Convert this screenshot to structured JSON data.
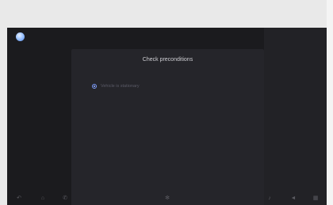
{
  "dialog": {
    "title": "Check preconditions",
    "items": [
      {
        "label": "Vehicle is stationary"
      }
    ]
  },
  "background": {
    "left_text": [
      "",
      ""
    ],
    "right_text": [
      "",
      ""
    ]
  },
  "icons": {
    "avatar": "avatar-icon",
    "bottom_left": [
      "back-icon",
      "home-icon",
      "phone-icon"
    ],
    "bottom_center": [
      "fan-icon"
    ],
    "bottom_right": [
      "music-icon",
      "volume-icon",
      "apps-icon"
    ]
  },
  "colors": {
    "screen_bg": "#1b1b1e",
    "dialog_bg": "#25252a",
    "accent": "#7b9cff"
  }
}
